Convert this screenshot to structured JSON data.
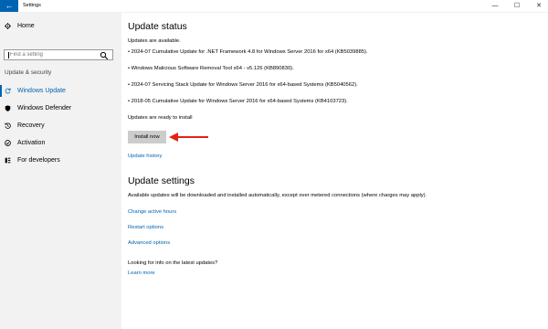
{
  "window": {
    "title": "Settings",
    "back_glyph": "←",
    "minimize_glyph": "—",
    "maximize_glyph": "☐",
    "close_glyph": "✕"
  },
  "sidebar": {
    "home": {
      "label": "Home",
      "icon": "gear-icon"
    },
    "search_placeholder": "Find a setting",
    "section_label": "Update & security",
    "items": [
      {
        "label": "Windows Update",
        "icon": "refresh-icon",
        "active": true
      },
      {
        "label": "Windows Defender",
        "icon": "shield-icon",
        "active": false
      },
      {
        "label": "Recovery",
        "icon": "history-icon",
        "active": false
      },
      {
        "label": "Activation",
        "icon": "check-circle-icon",
        "active": false
      },
      {
        "label": "For developers",
        "icon": "developer-icon",
        "active": false
      }
    ]
  },
  "main": {
    "update_status": {
      "heading": "Update status",
      "available_text": "Updates are available.",
      "updates": [
        "• 2024-07 Cumulative Update for .NET Framework 4.8 for Windows Server 2016 for x64 (KB5039885).",
        "• Windows Malicious Software Removal Tool x64 - v5.126 (KB890830).",
        "• 2024-07 Servicing Stack Update for Windows Server 2016 for x64-based Systems (KB5040562).",
        "• 2018-05 Cumulative Update for Windows Server 2016 for x64-based Systems (KB4103723)."
      ],
      "ready_text": "Updates are ready to install",
      "install_button": "Install now",
      "history_link": "Update history"
    },
    "update_settings": {
      "heading": "Update settings",
      "description": "Available updates will be downloaded and installed automatically, except over metered connections (where charges may apply).",
      "links": [
        "Change active hours",
        "Restart options",
        "Advanced options"
      ],
      "info_prompt": "Looking for info on the latest updates?",
      "learn_more": "Learn more"
    }
  },
  "colors": {
    "accent": "#0063b1",
    "sidebar_bg": "#f2f2f2",
    "button_bg": "#cccccc",
    "annotation_arrow": "#e2231a"
  }
}
